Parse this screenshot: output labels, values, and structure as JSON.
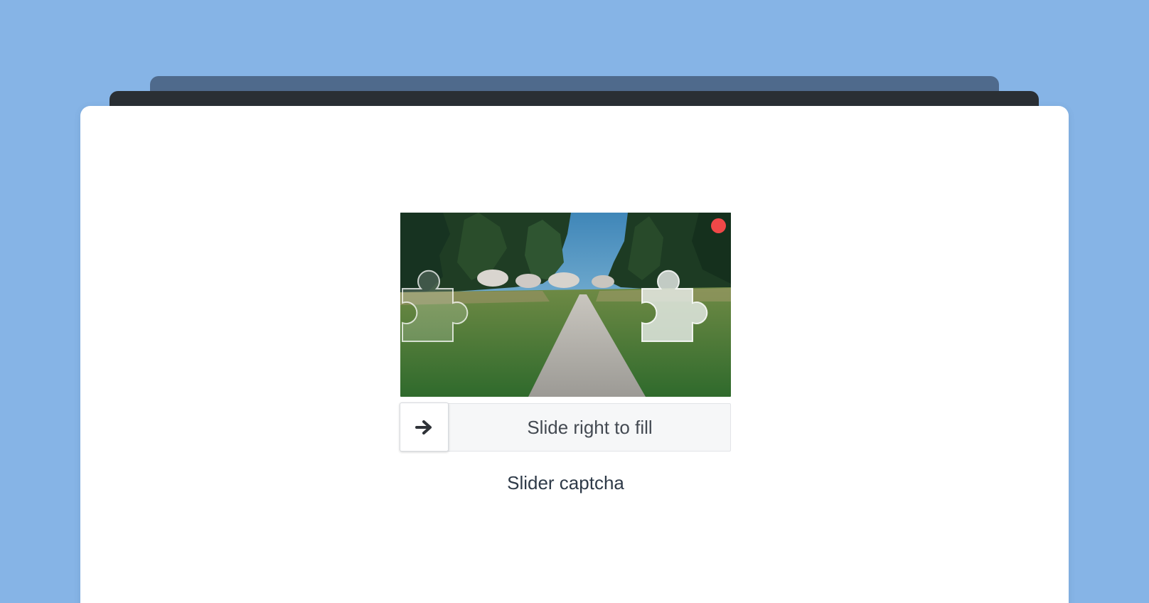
{
  "captcha": {
    "slider_label": "Slide right to fill",
    "caption": "Slider captcha",
    "handle_icon": "arrow-right-icon",
    "refresh_icon": "refresh-dot",
    "slider_progress": 0,
    "image_description": "",
    "colors": {
      "refresh": "#f04848",
      "track": "#f6f7f8",
      "background": "#86b4e6",
      "card": "#ffffff"
    }
  }
}
